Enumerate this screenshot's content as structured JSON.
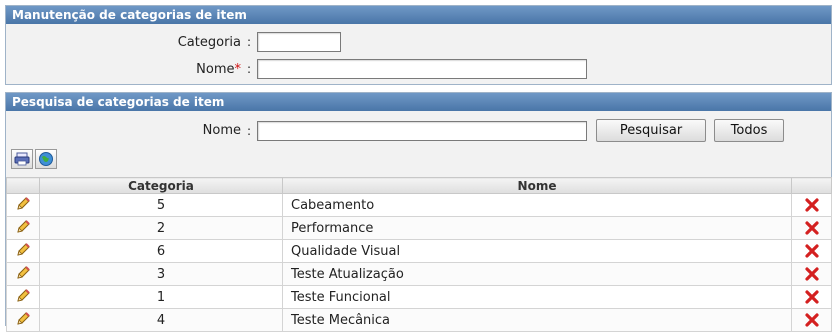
{
  "manutencao": {
    "title": "Manutenção de categorias de item",
    "categoria_label": "Categoria",
    "categoria_value": "",
    "nome_label": "Nome",
    "nome_required": "*",
    "nome_value": "",
    "colon": ":"
  },
  "pesquisa": {
    "title": "Pesquisa de categorias de item",
    "nome_label": "Nome",
    "nome_value": "",
    "colon": ":",
    "search_button": "Pesquisar",
    "all_button": "Todos",
    "toolbar_icons": [
      "print-icon",
      "globe-icon"
    ]
  },
  "grid": {
    "columns": [
      "Categoria",
      "Nome"
    ],
    "rows": [
      {
        "categoria": "5",
        "nome": "Cabeamento"
      },
      {
        "categoria": "2",
        "nome": "Performance"
      },
      {
        "categoria": "6",
        "nome": "Qualidade Visual"
      },
      {
        "categoria": "3",
        "nome": "Teste Atualização"
      },
      {
        "categoria": "1",
        "nome": "Teste Funcional"
      },
      {
        "categoria": "4",
        "nome": "Teste Mecânica"
      }
    ],
    "edit_icon": "pencil-icon",
    "delete_icon": "delete-x-icon"
  },
  "colors": {
    "header_bg": "#5a84b4",
    "required": "#d01010",
    "delete": "#d42020"
  }
}
